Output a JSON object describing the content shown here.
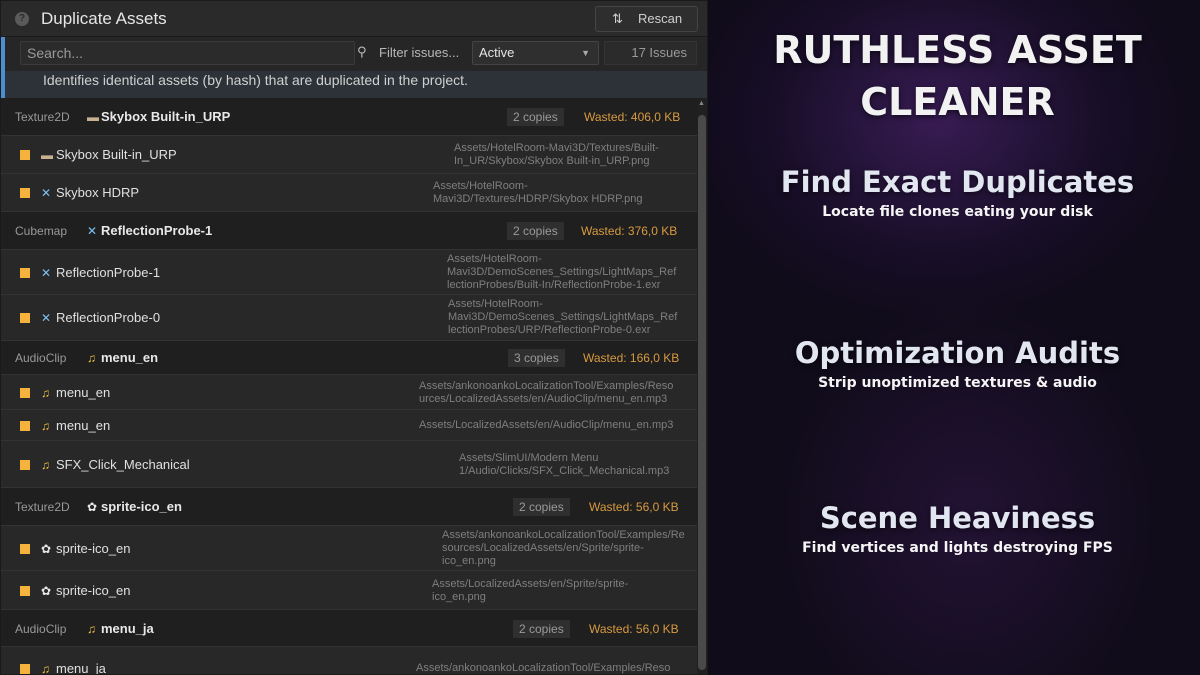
{
  "window": {
    "title": "Duplicate Assets",
    "rescan_label": "Rescan",
    "search_placeholder": "Search...",
    "filter_label": "Filter issues...",
    "status_value": "Active",
    "issue_count": "17 Issues",
    "info_text": "Identifies identical assets (by hash) that are duplicated in the project."
  },
  "groups": [
    {
      "type": "Texture2D",
      "icon": "texture-icon",
      "name": "Skybox Built-in_URP",
      "copies": "2 copies",
      "wasted": "Wasted: 406,0 KB",
      "items": [
        {
          "icon": "texture-icon",
          "name": "Skybox Built-in_URP",
          "path": [
            "Assets/HotelRoom-Mavi3D/Textures/Built-",
            "In_UR/Skybox/Skybox Built-in_URP.png"
          ]
        },
        {
          "icon": "hdr-icon",
          "name": "Skybox HDRP",
          "path": [
            "Assets/HotelRoom-",
            "Mavi3D/Textures/HDRP/Skybox HDRP.png"
          ]
        }
      ]
    },
    {
      "type": "Cubemap",
      "icon": "hdr-icon",
      "name": "ReflectionProbe-1",
      "copies": "2 copies",
      "wasted": "Wasted: 376,0 KB",
      "items": [
        {
          "icon": "hdr-icon",
          "name": "ReflectionProbe-1",
          "path": [
            "Assets/HotelRoom-",
            "Mavi3D/DemoScenes_Settings/LightMaps_Ref",
            "lectionProbes/Built-In/ReflectionProbe-1.exr"
          ]
        },
        {
          "icon": "hdr-icon",
          "name": "ReflectionProbe-0",
          "path": [
            "Assets/HotelRoom-",
            "Mavi3D/DemoScenes_Settings/LightMaps_Ref",
            "lectionProbes/URP/ReflectionProbe-0.exr"
          ]
        }
      ]
    },
    {
      "type": "AudioClip",
      "icon": "audio-icon",
      "name": "menu_en",
      "copies": "3 copies",
      "wasted": "Wasted: 166,0 KB",
      "items": [
        {
          "icon": "audio-icon",
          "name": "menu_en",
          "path": [
            "Assets/ankonoankoLocalizationTool/Examples/Reso",
            "urces/LocalizedAssets/en/AudioClip/menu_en.mp3"
          ]
        },
        {
          "icon": "audio-icon",
          "name": "menu_en",
          "path": [
            "Assets/LocalizedAssets/en/AudioClip/menu_en.mp3"
          ]
        },
        {
          "icon": "audio-icon",
          "name": "SFX_Click_Mechanical",
          "path": [
            "Assets/SlimUI/Modern Menu",
            "1/Audio/Clicks/SFX_Click_Mechanical.mp3"
          ]
        }
      ]
    },
    {
      "type": "Texture2D",
      "icon": "sprite-icon",
      "name": "sprite-ico_en",
      "copies": "2 copies",
      "wasted": "Wasted: 56,0 KB",
      "items": [
        {
          "icon": "sprite-icon",
          "name": "sprite-ico_en",
          "path": [
            "Assets/ankonoankoLocalizationTool/Examples/Re",
            "sources/LocalizedAssets/en/Sprite/sprite-",
            "ico_en.png"
          ]
        },
        {
          "icon": "sprite-icon",
          "name": "sprite-ico_en",
          "path": [
            "Assets/LocalizedAssets/en/Sprite/sprite-",
            "ico_en.png"
          ]
        }
      ]
    },
    {
      "type": "AudioClip",
      "icon": "audio-icon",
      "name": "menu_ja",
      "copies": "2 copies",
      "wasted": "Wasted: 56,0 KB",
      "items": [
        {
          "icon": "audio-icon",
          "name": "menu_ja",
          "path": [
            "Assets/ankonoankoLocalizationTool/Examples/Reso"
          ]
        }
      ]
    }
  ],
  "promo": {
    "title": "RUTHLESS ASSET CLEANER",
    "features": [
      {
        "heading": "Find Exact Duplicates",
        "sub": "Locate file clones eating your disk"
      },
      {
        "heading": "Optimization Audits",
        "sub": "Strip unoptimized textures & audio"
      },
      {
        "heading": "Scene Heaviness",
        "sub": "Find vertices and lights destroying FPS"
      }
    ]
  },
  "colors": {
    "accent": "#4a8fcf",
    "wasted": "#d89a40",
    "checkbox": "#f5b33e",
    "panel_bg": "#232323"
  }
}
